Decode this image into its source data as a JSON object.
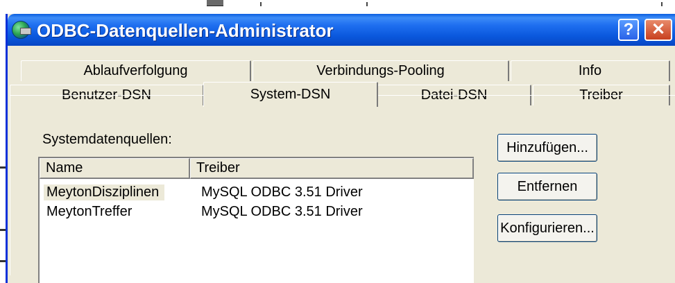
{
  "window": {
    "title": "ODBC-Datenquellen-Administrator",
    "help_glyph": "?",
    "close_glyph": "✕"
  },
  "tabs_row1": [
    {
      "label": "Ablaufverfolgung"
    },
    {
      "label": "Verbindungs-Pooling"
    },
    {
      "label": "Info"
    }
  ],
  "tabs_row2": [
    {
      "label": "Benutzer-DSN"
    },
    {
      "label": "System-DSN",
      "active": true
    },
    {
      "label": "Datei-DSN"
    },
    {
      "label": "Treiber"
    }
  ],
  "panel": {
    "list_label": "Systemdatenquellen:",
    "columns": [
      "Name",
      "Treiber"
    ],
    "rows": [
      {
        "name": "MeytonDisziplinen",
        "driver": "MySQL ODBC 3.51 Driver",
        "selected": true
      },
      {
        "name": "MeytonTreffer",
        "driver": "MySQL ODBC 3.51 Driver",
        "selected": false
      }
    ],
    "buttons": {
      "add": "Hinzufügen...",
      "remove": "Entfernen",
      "configure": "Konfigurieren..."
    }
  },
  "colors": {
    "titlebar": "#0a58dd",
    "dialog_bg": "#ece9d8",
    "close_button": "#c8401f"
  }
}
